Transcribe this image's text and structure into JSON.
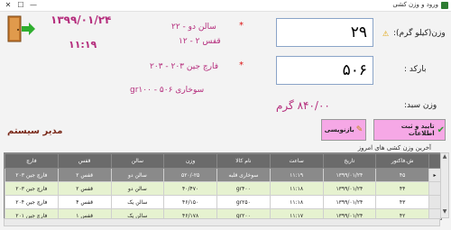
{
  "window": {
    "title": "ورود و وزن کشی",
    "minimize": "—",
    "maximize": "☐",
    "close": "✕"
  },
  "header": {
    "date": "۱۳۹۹/۰۱/۲۴",
    "time": "۱۱:۱۹"
  },
  "lines": {
    "hall": "سالن دو - ۲۲",
    "cage": "قفس ۲ - ۱۲",
    "broiler": "فارچ جین ۲۰۳ - ۲۰۳",
    "fuel": "سوخاری ۵۰۶ - gr۱۰۰"
  },
  "fields": {
    "weight_label": "وزن(کیلو گرم):",
    "weight_value": "۲۹",
    "barcode_label": "بارکد :",
    "barcode_value": "۵۰۶",
    "stock_label": "وزن سبد:",
    "stock_value": "۸۴۰/۰۰ گرم"
  },
  "user": {
    "role": "مدیر سیستم"
  },
  "buttons": {
    "confirm": "تایید و ثبت اطلاعات",
    "reset": "بازنویسی"
  },
  "grid": {
    "caption": "آخرین وزن کشی های امروز",
    "columns": [
      "ش.فاکتور",
      "تاریخ",
      "ساعت",
      "نام کالا",
      "وزن",
      "سالن",
      "قفس",
      "فارچ"
    ],
    "rows": [
      [
        "۴۵",
        "۱۳۹۹/۰۱/۲۴",
        "۱۱:۱۹",
        "سوخاری قلبه",
        "۲۵-/۵۲۰",
        "سالن دو",
        "قفس ۲",
        "فارچ جین ۲۰۳"
      ],
      [
        "۴۴",
        "۱۳۹۹/۰۱/۲۴",
        "۱۱:۱۸",
        "gr۴۰۰",
        "۴۰/۴۷۰",
        "سالن دو",
        "قفس ۲",
        "فارچ جین ۲۰۳"
      ],
      [
        "۴۳",
        "۱۳۹۹/۰۱/۲۴",
        "۱۱:۱۸",
        "gr۲۵۰",
        "۴۶/۱۵۰",
        "سالن یک",
        "قفس ۴",
        "فارچ جین ۲۰۴"
      ],
      [
        "۴۲",
        "۱۳۹۹/۰۱/۲۴",
        "۱۱:۱۷",
        "gr۲۰۰",
        "۴۶/۱۷۸",
        "سالن یک",
        "قفس ۱",
        "فارچ جین ۲۰۱"
      ]
    ]
  },
  "colors": {
    "accent": "#b52e7d",
    "button_bg": "#f6a8e6",
    "grid_header": "#6b6b6b",
    "row_highlight": "#e6f2d0"
  }
}
